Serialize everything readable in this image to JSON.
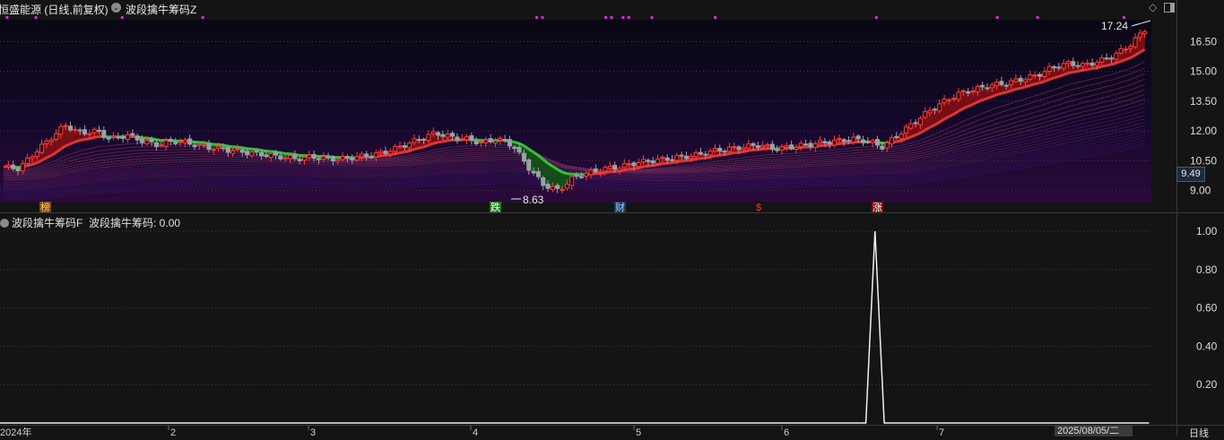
{
  "header": {
    "stock_title": "恒盛能源 (日线,前复权)",
    "indicator_title": "波段擒牛筹码Z"
  },
  "sub_panel": {
    "title": "波段擒牛筹码F",
    "value_label": "波段擒牛筹码: 0.00"
  },
  "status": {
    "current_price": "9.49",
    "date_box": "2025/08/05/二",
    "period": "日线"
  },
  "colors": {
    "up": "#ff3b3b",
    "down": "#9aa0a8",
    "ribbon_up": "#8b0f12",
    "ribbon_down": "#0f5a12",
    "line_red": "#e0343a",
    "line_green": "#33c23a",
    "marker": "#d92bd9"
  },
  "chart_data": [
    {
      "type": "candlestick",
      "yticks": [
        "16.50",
        "15.00",
        "13.50",
        "12.00",
        "10.50",
        "9.00"
      ],
      "ylim": [
        8.4,
        17.6
      ],
      "x_ticks": [
        "2024年",
        "2",
        "3",
        "4",
        "5",
        "6",
        "7"
      ],
      "annotations": {
        "high_label": "17.24",
        "low_label": "8.63"
      },
      "event_markers": [
        "榜",
        "跌",
        "财",
        "$",
        "涨"
      ],
      "close_path": [
        10.2,
        10.1,
        10.9,
        11.6,
        12.3,
        11.9,
        12.0,
        11.6,
        11.8,
        11.5,
        11.3,
        11.5,
        11.4,
        11.2,
        11.1,
        11.0,
        10.9,
        10.8,
        10.7,
        10.6,
        10.7,
        10.6,
        10.6,
        10.7,
        10.8,
        11.0,
        11.3,
        11.6,
        11.9,
        11.7,
        11.6,
        11.4,
        11.6,
        11.3,
        10.2,
        9.3,
        9.0,
        9.7,
        9.9,
        10.1,
        10.2,
        10.4,
        10.5,
        10.6,
        10.7,
        10.8,
        11.0,
        11.1,
        11.2,
        11.3,
        11.1,
        11.2,
        11.3,
        11.4,
        11.5,
        11.6,
        11.5,
        11.2,
        11.8,
        12.4,
        13.0,
        13.5,
        13.9,
        14.1,
        14.3,
        14.4,
        14.6,
        14.8,
        15.2,
        15.4,
        15.3,
        15.5,
        15.8,
        16.3,
        17.1
      ]
    },
    {
      "type": "line",
      "yticks": [
        "1.00",
        "0.80",
        "0.60",
        "0.40",
        "0.20"
      ],
      "ylim": [
        0,
        1
      ],
      "series": [
        {
          "values": [
            0,
            0,
            1,
            0,
            0
          ],
          "x_fraction": [
            0,
            0.752,
            0.76,
            0.768,
            0.998
          ]
        }
      ]
    }
  ]
}
